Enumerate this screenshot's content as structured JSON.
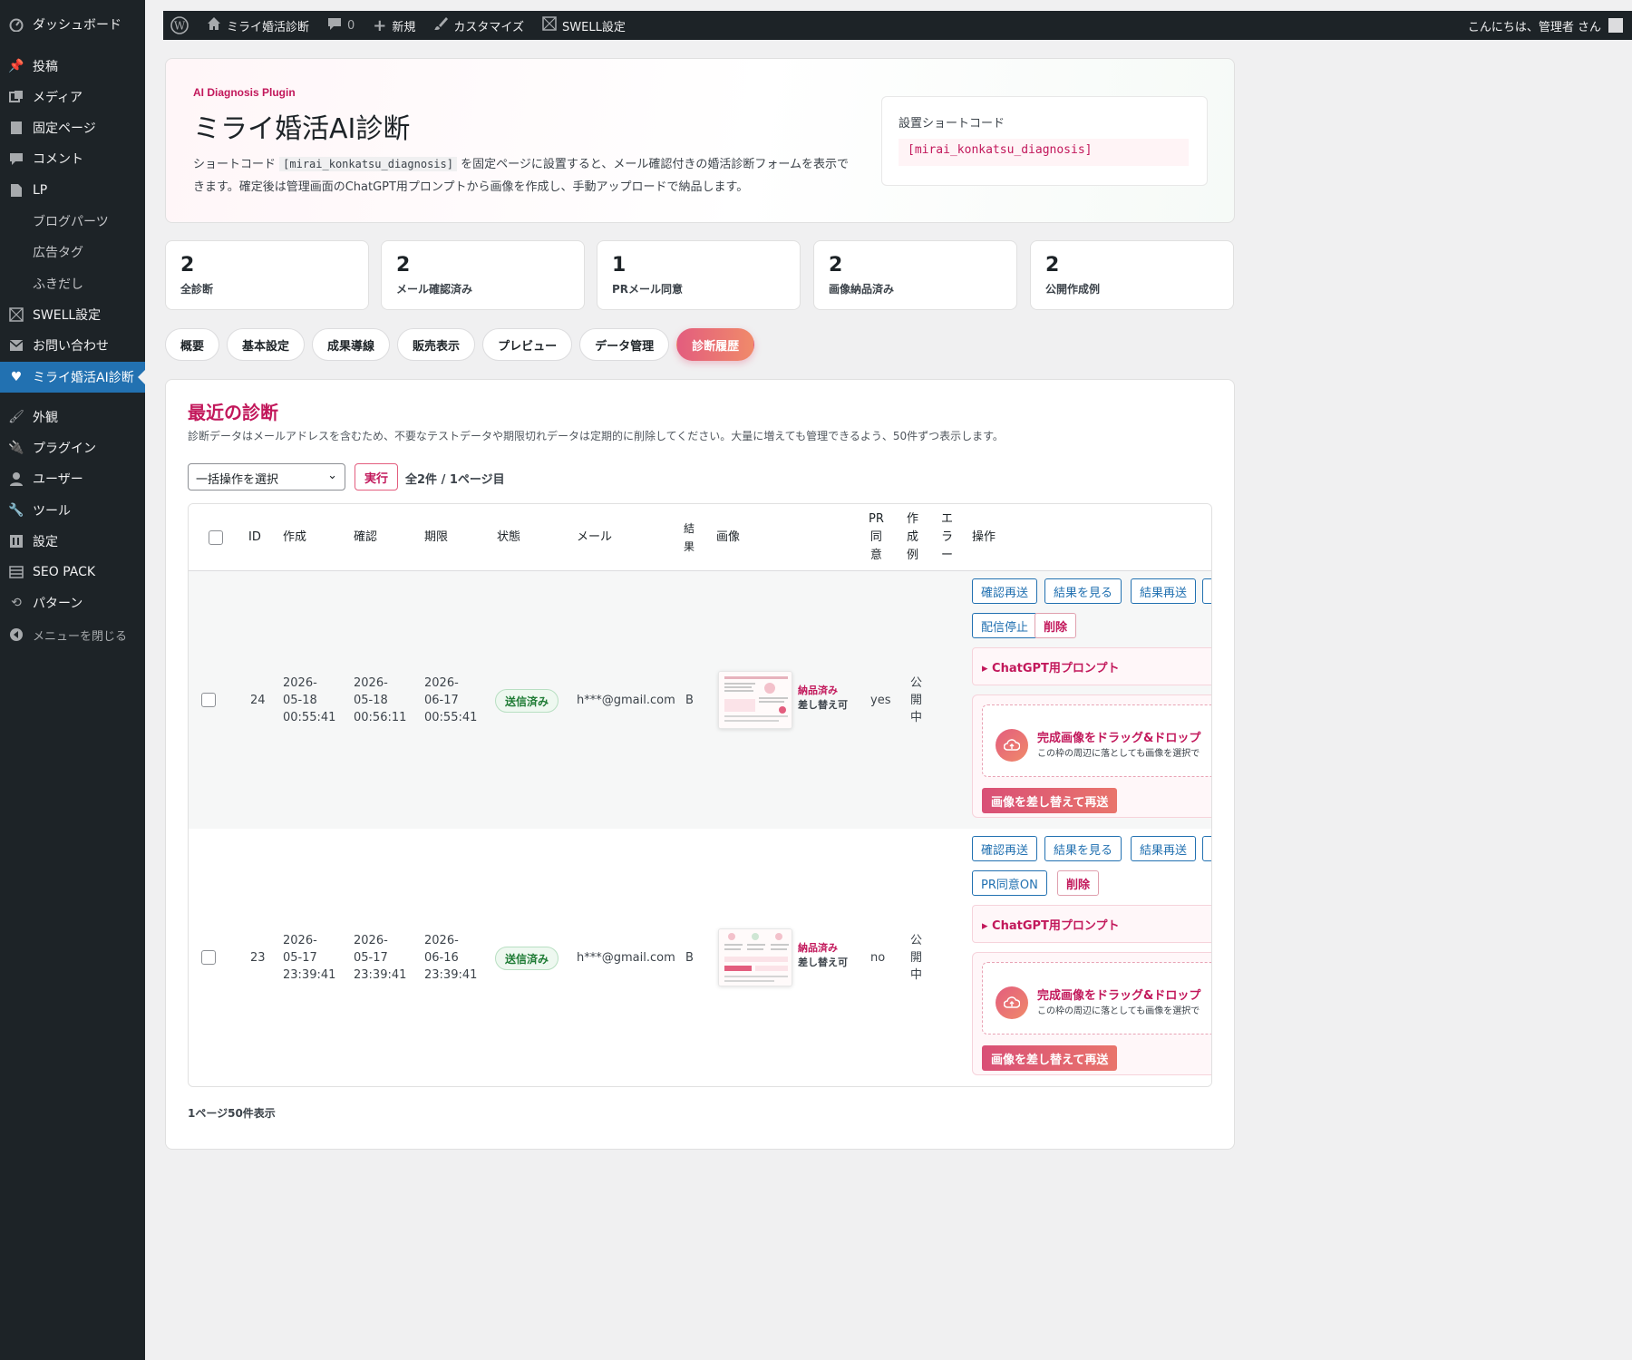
{
  "sidebar": {
    "items": [
      {
        "label": "ダッシュボード",
        "icon": "dashboard-icon"
      },
      {
        "label": "投稿",
        "icon": "pin-icon"
      },
      {
        "label": "メディア",
        "icon": "media-icon"
      },
      {
        "label": "固定ページ",
        "icon": "page-icon"
      },
      {
        "label": "コメント",
        "icon": "comment-icon"
      },
      {
        "label": "LP",
        "icon": "page-icon"
      },
      {
        "label": "ブログパーツ",
        "icon": ""
      },
      {
        "label": "広告タグ",
        "icon": ""
      },
      {
        "label": "ふきだし",
        "icon": ""
      },
      {
        "label": "SWELL設定",
        "icon": "swell-icon"
      },
      {
        "label": "お問い合わせ",
        "icon": "mail-icon"
      },
      {
        "label": "ミライ婚活AI診断",
        "icon": "heart-icon"
      },
      {
        "label": "外観",
        "icon": "brush-icon"
      },
      {
        "label": "プラグイン",
        "icon": "plugin-icon"
      },
      {
        "label": "ユーザー",
        "icon": "user-icon"
      },
      {
        "label": "ツール",
        "icon": "wrench-icon"
      },
      {
        "label": "設定",
        "icon": "settings-icon"
      },
      {
        "label": "SEO PACK",
        "icon": "list-icon"
      },
      {
        "label": "パターン",
        "icon": "refresh-icon"
      },
      {
        "label": "メニューを閉じる",
        "icon": "collapse-icon"
      }
    ]
  },
  "adminbar": {
    "site": "ミライ婚活診断",
    "comments": "0",
    "new": "新規",
    "customize": "カスタマイズ",
    "swell": "SWELL設定",
    "greeting": "こんにちは、管理者 さん"
  },
  "hero": {
    "eyebrow": "AI Diagnosis Plugin",
    "title": "ミライ婚活AI診断",
    "desc_pre": "ショートコード ",
    "desc_code": "[mirai_konkatsu_diagnosis]",
    "desc_post": " を固定ページに設置すると、メール確認付きの婚活診断フォームを表示できます。確定後は管理画面のChatGPT用プロンプトから画像を作成し、手動アップロードで納品します。",
    "shortcode_label": "設置ショートコード",
    "shortcode": "[mirai_konkatsu_diagnosis]"
  },
  "stats": [
    {
      "num": "2",
      "cap": "全診断"
    },
    {
      "num": "2",
      "cap": "メール確認済み"
    },
    {
      "num": "1",
      "cap": "PRメール同意"
    },
    {
      "num": "2",
      "cap": "画像納品済み"
    },
    {
      "num": "2",
      "cap": "公開作成例"
    }
  ],
  "tabs": [
    "概要",
    "基本設定",
    "成果導線",
    "販売表示",
    "プレビュー",
    "データ管理",
    "診断履歴"
  ],
  "active_tab": "診断履歴",
  "panel": {
    "title": "最近の診断",
    "desc": "診断データはメールアドレスを含むため、不要なテストデータや期限切れデータは定期的に削除してください。大量に増えても管理できるよう、50件ずつ表示します。",
    "bulk_placeholder": "一括操作を選択",
    "apply": "実行",
    "count": "全2件 / 1ページ目",
    "footnote": "1ページ50件表示"
  },
  "columns": {
    "id": "ID",
    "created": "作成",
    "confirmed": "確認",
    "expires": "期限",
    "status": "状態",
    "email": "メール",
    "result": "結\n果",
    "image": "画像",
    "pr": "PR\n同\n意",
    "example": "作\n成\n例",
    "error": "エ\nラ\nー",
    "actions": "操作"
  },
  "rows": [
    {
      "id": "24",
      "created": "2026-\n05-18\n00:55:41",
      "confirmed": "2026-\n05-18\n00:56:11",
      "expires": "2026-\n06-17\n00:55:41",
      "status": "送信済み",
      "email": "h***@gmail.com",
      "result": "B",
      "delivered": "納品済み",
      "replaceable": "差し替え可",
      "pr": "yes",
      "example": "公\n開\n中",
      "btn1": "確認再送",
      "btn2": "結果を見る",
      "btn3": "結果再送",
      "btn4": "配信停止",
      "btn_del": "削除",
      "prompt": "▸ ChatGPT用プロンプト",
      "drop_title": "完成画像をドラッグ&ドロップ",
      "drop_sub": "この枠の周辺に落としても画像を選択で",
      "replace_btn": "画像を差し替えて再送"
    },
    {
      "id": "23",
      "created": "2026-\n05-17\n23:39:41",
      "confirmed": "2026-\n05-17\n23:39:41",
      "expires": "2026-\n06-16\n23:39:41",
      "status": "送信済み",
      "email": "h***@gmail.com",
      "result": "B",
      "delivered": "納品済み",
      "replaceable": "差し替え可",
      "pr": "no",
      "example": "公\n開\n中",
      "btn1": "確認再送",
      "btn2": "結果を見る",
      "btn3": "結果再送",
      "btn4": "PR同意ON",
      "btn_del": "削除",
      "prompt": "▸ ChatGPT用プロンプト",
      "drop_title": "完成画像をドラッグ&ドロップ",
      "drop_sub": "この枠の周辺に落としても画像を選択で",
      "replace_btn": "画像を差し替えて再送"
    }
  ]
}
